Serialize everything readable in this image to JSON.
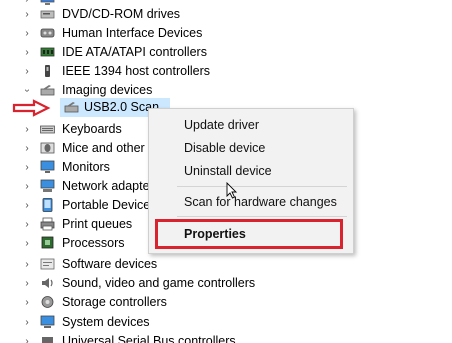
{
  "tree": {
    "items": [
      {
        "label": "Computer (partial)",
        "icon": "computer-icon",
        "expanded": false
      },
      {
        "label": "DVD/CD-ROM drives",
        "icon": "dvd-drive-icon",
        "expanded": false
      },
      {
        "label": "Human Interface Devices",
        "icon": "hid-icon",
        "expanded": false
      },
      {
        "label": "IDE ATA/ATAPI controllers",
        "icon": "ide-controller-icon",
        "expanded": false
      },
      {
        "label": "IEEE 1394 host controllers",
        "icon": "ieee1394-icon",
        "expanded": false
      },
      {
        "label": "Imaging devices",
        "icon": "imaging-device-icon",
        "expanded": true
      },
      {
        "label": "USB2.0 Scan",
        "icon": "scanner-icon",
        "selected": true
      },
      {
        "label": "Keyboards",
        "icon": "keyboard-icon",
        "expanded": false
      },
      {
        "label": "Mice and other",
        "icon": "mouse-icon",
        "expanded": false
      },
      {
        "label": "Monitors",
        "icon": "monitor-icon",
        "expanded": false
      },
      {
        "label": "Network adapte",
        "icon": "network-adapter-icon",
        "expanded": false
      },
      {
        "label": "Portable Device",
        "icon": "portable-device-icon",
        "expanded": false
      },
      {
        "label": "Print queues",
        "icon": "printer-icon",
        "expanded": false
      },
      {
        "label": "Processors",
        "icon": "processor-icon",
        "expanded": false
      },
      {
        "label": "Software devices",
        "icon": "software-device-icon",
        "expanded": false
      },
      {
        "label": "Sound, video and game controllers",
        "icon": "sound-icon",
        "expanded": false
      },
      {
        "label": "Storage controllers",
        "icon": "storage-controller-icon",
        "expanded": false
      },
      {
        "label": "System devices",
        "icon": "system-device-icon",
        "expanded": false
      },
      {
        "label": "Universal Serial Bus controllers",
        "icon": "usb-controller-icon",
        "expanded": false
      }
    ]
  },
  "context_menu": {
    "update_driver": "Update driver",
    "disable_device": "Disable device",
    "uninstall_device": "Uninstall device",
    "scan_hardware": "Scan for hardware changes",
    "properties": "Properties"
  },
  "colors": {
    "selection": "#cce8ff",
    "annotation_red": "#d9232e",
    "menu_bg": "#f2f2f2"
  }
}
